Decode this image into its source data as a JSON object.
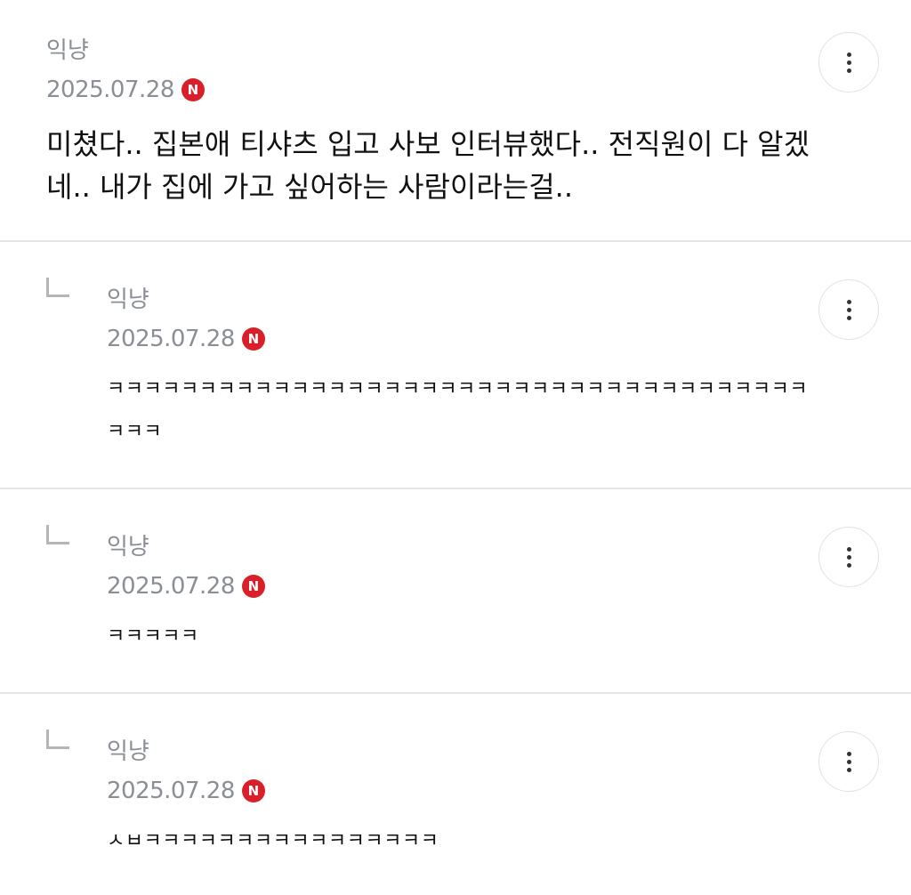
{
  "comments": [
    {
      "author": "익냥",
      "date": "2025.07.28",
      "badge": "N",
      "text": "미쳤다.. 집본애 티샤츠 입고 사보 인터뷰했다.. 전직원이 다 알겠네.. 내가 집에 가고 싶어하는 사람이라는걸.."
    },
    {
      "author": "익냥",
      "date": "2025.07.28",
      "badge": "N",
      "text": "ㅋㅋㅋㅋㅋㅋㅋㅋㅋㅋㅋㅋㅋㅋㅋㅋㅋㅋㅋㅋㅋㅋㅋㅋㅋㅋㅋㅋㅋㅋㅋㅋㅋㅋㅋㅋㅋㅋㅋㅋㅋ"
    },
    {
      "author": "익냥",
      "date": "2025.07.28",
      "badge": "N",
      "text": "ㅋㅋㅋㅋㅋ"
    },
    {
      "author": "익냥",
      "date": "2025.07.28",
      "badge": "N",
      "text": "ㅅㅂㅋㅋㅋㅋㅋㅋㅋㅋㅋㅋㅋㅋㅋㅋㅋㅋ"
    }
  ]
}
